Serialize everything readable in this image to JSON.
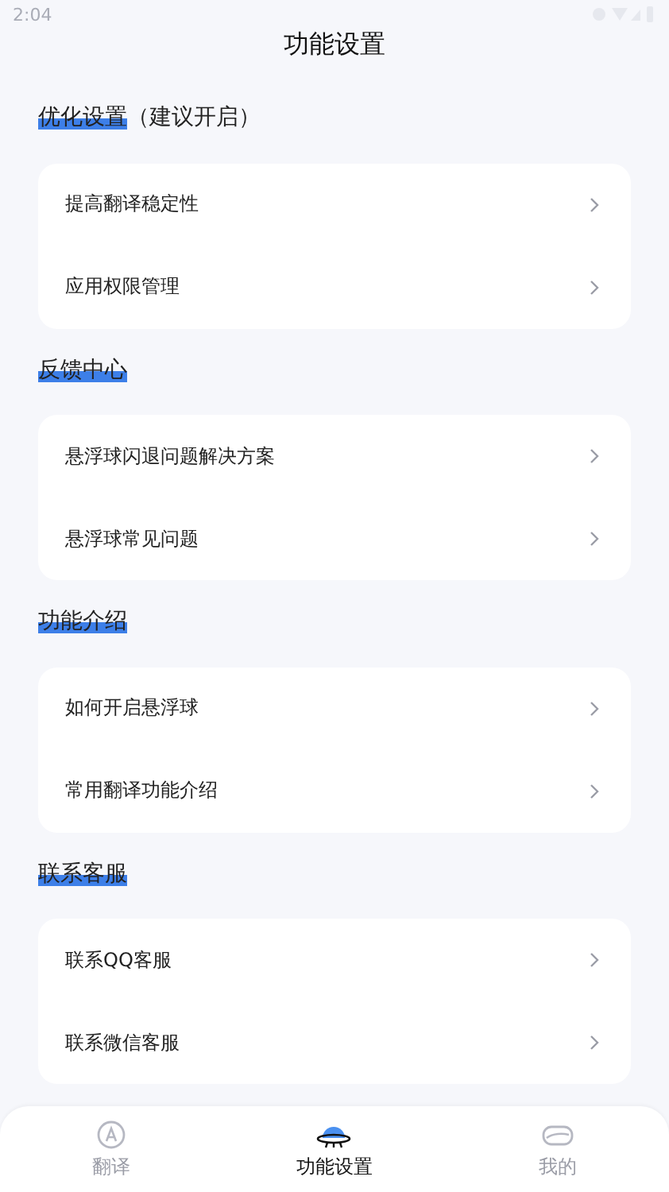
{
  "status_bar": {
    "time": "2:04"
  },
  "header": {
    "title": "功能设置"
  },
  "sections": [
    {
      "title": "优化设置",
      "note": "（建议开启）",
      "items": [
        {
          "label": "提高翻译稳定性"
        },
        {
          "label": "应用权限管理"
        }
      ]
    },
    {
      "title": "反馈中心",
      "items": [
        {
          "label": "悬浮球闪退问题解决方案"
        },
        {
          "label": "悬浮球常见问题"
        }
      ]
    },
    {
      "title": "功能介绍",
      "items": [
        {
          "label": "如何开启悬浮球"
        },
        {
          "label": "常用翻译功能介绍"
        }
      ]
    },
    {
      "title": "联系客服",
      "items": [
        {
          "label": "联系QQ客服"
        },
        {
          "label": "联系微信客服"
        }
      ]
    }
  ],
  "tab_bar": [
    {
      "kind": "translate",
      "label": "翻译",
      "selected": false
    },
    {
      "kind": "ufo",
      "label": "功能设置",
      "selected": true
    },
    {
      "kind": "profile",
      "label": "我的",
      "selected": false
    }
  ]
}
